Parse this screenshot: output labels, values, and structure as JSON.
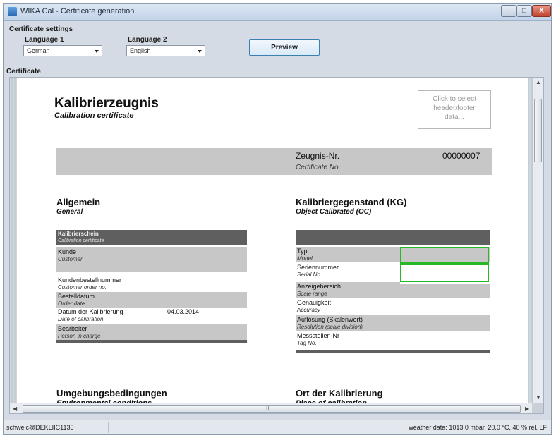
{
  "window": {
    "title": "WIKA Cal - Certificate generation",
    "controls": {
      "minimize": "–",
      "maximize": "□",
      "close": "X"
    }
  },
  "settings": {
    "section_label": "Certificate settings",
    "language1": {
      "label": "Language 1",
      "value": "German"
    },
    "language2": {
      "label": "Language 2",
      "value": "English"
    },
    "preview_label": "Preview"
  },
  "certificate": {
    "section_label": "Certificate",
    "title": "Kalibrierzeugnis",
    "subtitle": "Calibration certificate",
    "header_footer_box": [
      "Click to select",
      "header/footer",
      "data..."
    ],
    "cert_no_label": "Zeugnis-Nr.",
    "cert_no_label_en": "Certificate No.",
    "cert_no_value": "00000007",
    "general": {
      "title": "Allgemein",
      "title_en": "General",
      "header": "Kalibrierschein",
      "header_en": "Calibration certificate",
      "rows": [
        {
          "de": "Kunde",
          "en": "Customer",
          "value": ""
        },
        {
          "de": "Kundenbestellnummer",
          "en": "Customer order no.",
          "value": ""
        },
        {
          "de": "Bestelldatum",
          "en": "Order date",
          "value": ""
        },
        {
          "de": "Datum der Kalibrierung",
          "en": "Date of calibration",
          "value": "04.03.2014"
        },
        {
          "de": "Bearbeiter",
          "en": "Person in charge",
          "value": ""
        }
      ]
    },
    "object": {
      "title": "Kalibriergegenstand (KG)",
      "title_en": "Object Calibrated (OC)",
      "rows": [
        {
          "de": "Typ",
          "en": "Model"
        },
        {
          "de": "Seriennummer",
          "en": "Serial No."
        },
        {
          "de": "Anzeigebereich",
          "en": "Scale range"
        },
        {
          "de": "Genauigkeit",
          "en": "Accuracy"
        },
        {
          "de": "Auflösung (Skalenwert)",
          "en": "Resolution (scale division)"
        },
        {
          "de": "Messstellen-Nr",
          "en": "Tag No."
        }
      ]
    },
    "environment": {
      "title": "Umgebungsbedingungen",
      "title_en": "Environmental conditions"
    },
    "place": {
      "title": "Ort der Kalibrierung",
      "title_en": "Place of calibration"
    }
  },
  "scrollbar": {
    "h_middle": "III"
  },
  "status": {
    "user": "schweic@DEKLIIC1135",
    "weather": "weather data: 1013.0 mbar, 20.0 °C, 40 % rel. LF"
  },
  "colors": {
    "highlight": "#27b827",
    "dark_row": "#5f5f5f",
    "grey_row": "#c7c7c7"
  }
}
